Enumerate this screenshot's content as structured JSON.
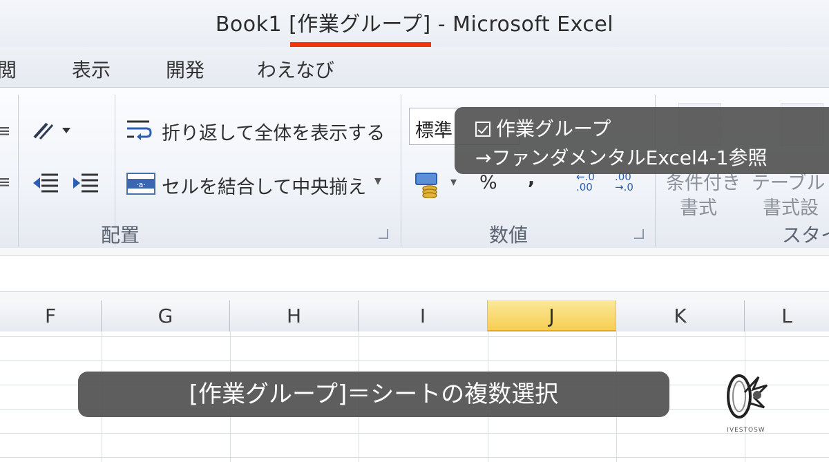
{
  "window": {
    "title": "Book1  [作業グループ]  -  Microsoft Excel"
  },
  "ribbon_tabs": [
    "閲",
    "表示",
    "開発",
    "わえなび"
  ],
  "ribbon": {
    "alignment": {
      "wrap_text_label": "折り返して全体を表示する",
      "merge_center_label": "セルを結合して中央揃え",
      "dropdown_arrow": "▾",
      "group_title": "配置"
    },
    "number": {
      "format_value": "標準",
      "percent_symbol": "%",
      "comma_symbol": ",",
      "increase_decimal": "←.0 .00",
      "decrease_decimal": ".00 →.0",
      "group_title": "数値"
    },
    "styles": {
      "conditional_formatting_label": "条件付き",
      "conditional_formatting_label2": "書式",
      "format_as_table_label": "テーブル",
      "format_as_table_label2": "書式設",
      "group_title": "スタイ"
    }
  },
  "columns": [
    "F",
    "G",
    "H",
    "I",
    "J",
    "K",
    "L"
  ],
  "selected_column": "J",
  "tooltip": {
    "line1": "作業グループ",
    "line2": "→ファンダメンタルExcel4-1参照"
  },
  "caption": "[作業グループ]＝シートの複数選択",
  "watermark": {
    "text": "IVESTOSW"
  },
  "colors": {
    "title_underline": "#f2350e",
    "selected_column": "#f6cf52",
    "overlay": "#505050"
  }
}
